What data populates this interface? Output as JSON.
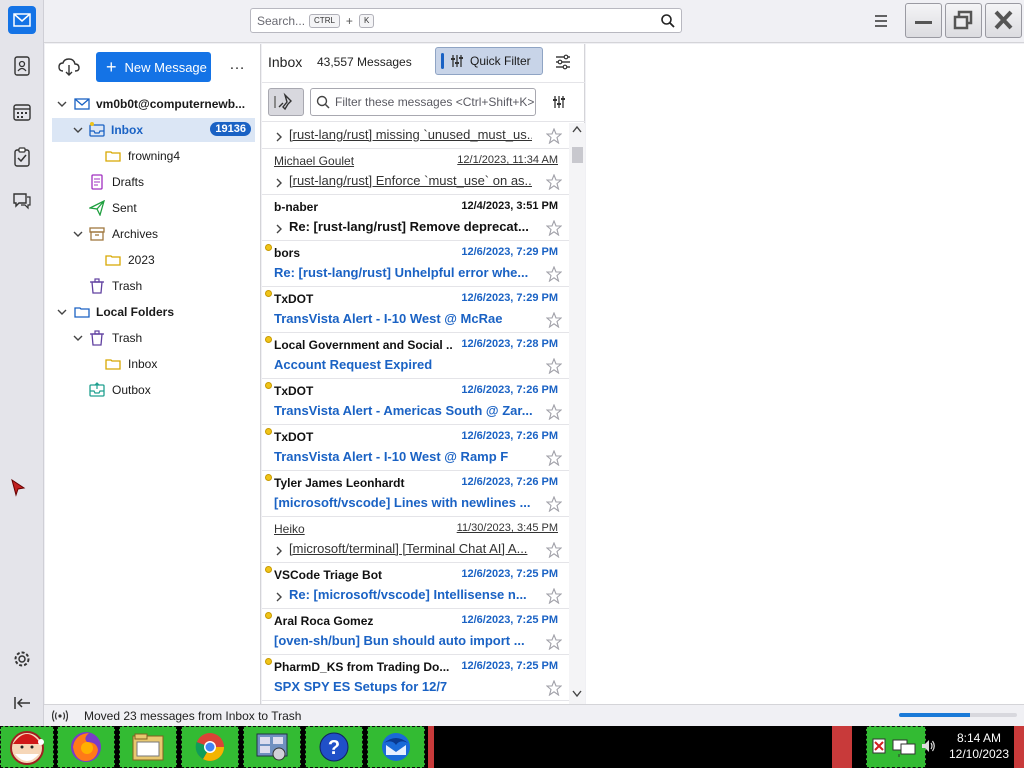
{
  "titlebar": {
    "search_placeholder": "Search...",
    "search_kbd1": "CTRL",
    "search_plus": "+",
    "search_kbd2": "K"
  },
  "spaces": {
    "items": [
      "mail-icon",
      "address-book-icon",
      "calendar-icon",
      "tasks-icon",
      "chat-icon"
    ],
    "bottom": [
      "settings-icon",
      "collapse-icon"
    ]
  },
  "folderpane": {
    "new_message_label": "New Message",
    "more_label": "…",
    "account": "vm0b0t@computernewb...",
    "inbox_label": "Inbox",
    "inbox_unread": "19136",
    "frowning_label": "frowning4",
    "drafts_label": "Drafts",
    "sent_label": "Sent",
    "archives_label": "Archives",
    "archive_2023_label": "2023",
    "trash_label": "Trash",
    "local_folders_label": "Local Folders",
    "local_trash_label": "Trash",
    "local_inbox_label": "Inbox",
    "outbox_label": "Outbox"
  },
  "threadpane": {
    "folder_name": "Inbox",
    "message_count": "43,557 Messages",
    "quick_filter_label": "Quick Filter",
    "filter_placeholder": "Filter these messages <Ctrl+Shift+K>"
  },
  "messages": [
    {
      "sender": "",
      "date": "",
      "subject": "[rust-lang/rust] missing `unused_must_us...",
      "state": "read",
      "thread": true
    },
    {
      "sender": "Michael Goulet",
      "date": "12/1/2023, 11:34 AM",
      "subject": "[rust-lang/rust] Enforce `must_use` on as...",
      "state": "read",
      "thread": true
    },
    {
      "sender": "b-naber",
      "date": "12/4/2023, 3:51 PM",
      "subject": "Re: [rust-lang/rust] Remove deprecat...",
      "state": "bold",
      "thread": true
    },
    {
      "sender": "bors",
      "date": "12/6/2023, 7:29 PM",
      "subject": "Re: [rust-lang/rust] Unhelpful error whe...",
      "state": "unread",
      "thread": false
    },
    {
      "sender": "TxDOT",
      "date": "12/6/2023, 7:29 PM",
      "subject": "TransVista Alert - I-10 West @ McRae",
      "state": "unread",
      "thread": false
    },
    {
      "sender": "Local Government and Social ...",
      "date": "12/6/2023, 7:28 PM",
      "subject": "Account Request Expired",
      "state": "unread",
      "thread": false
    },
    {
      "sender": "TxDOT",
      "date": "12/6/2023, 7:26 PM",
      "subject": "TransVista Alert - Americas South @ Zar...",
      "state": "unread",
      "thread": false
    },
    {
      "sender": "TxDOT",
      "date": "12/6/2023, 7:26 PM",
      "subject": "TransVista Alert - I-10 West @ Ramp F",
      "state": "unread",
      "thread": false
    },
    {
      "sender": "Tyler James Leonhardt",
      "date": "12/6/2023, 7:26 PM",
      "subject": "[microsoft/vscode] Lines with newlines ...",
      "state": "unread",
      "thread": false
    },
    {
      "sender": "Heiko",
      "date": "11/30/2023, 3:45 PM",
      "subject": "[microsoft/terminal] [Terminal Chat AI] A...",
      "state": "read",
      "thread": true
    },
    {
      "sender": "VSCode Triage Bot",
      "date": "12/6/2023, 7:25 PM",
      "subject": "Re: [microsoft/vscode] Intellisense n...",
      "state": "unread",
      "thread": true
    },
    {
      "sender": "Aral Roca Gomez",
      "date": "12/6/2023, 7:25 PM",
      "subject": "[oven-sh/bun] Bun should auto import ...",
      "state": "unread",
      "thread": false
    },
    {
      "sender": "PharmD_KS from Trading Do...",
      "date": "12/6/2023, 7:25 PM",
      "subject": "SPX SPY ES Setups for 12/7",
      "state": "unread",
      "thread": false
    }
  ],
  "statusbar": {
    "text": "Moved 23 messages from Inbox to Trash",
    "progress": 0.6
  },
  "taskbar": {
    "clock_time": "8:14 AM",
    "clock_date": "12/10/2023"
  },
  "colors": {
    "accent": "#1473e6",
    "unread": "#1a62c4",
    "taskbar_green": "#33bb33",
    "taskbar_red": "#c83a3a"
  }
}
